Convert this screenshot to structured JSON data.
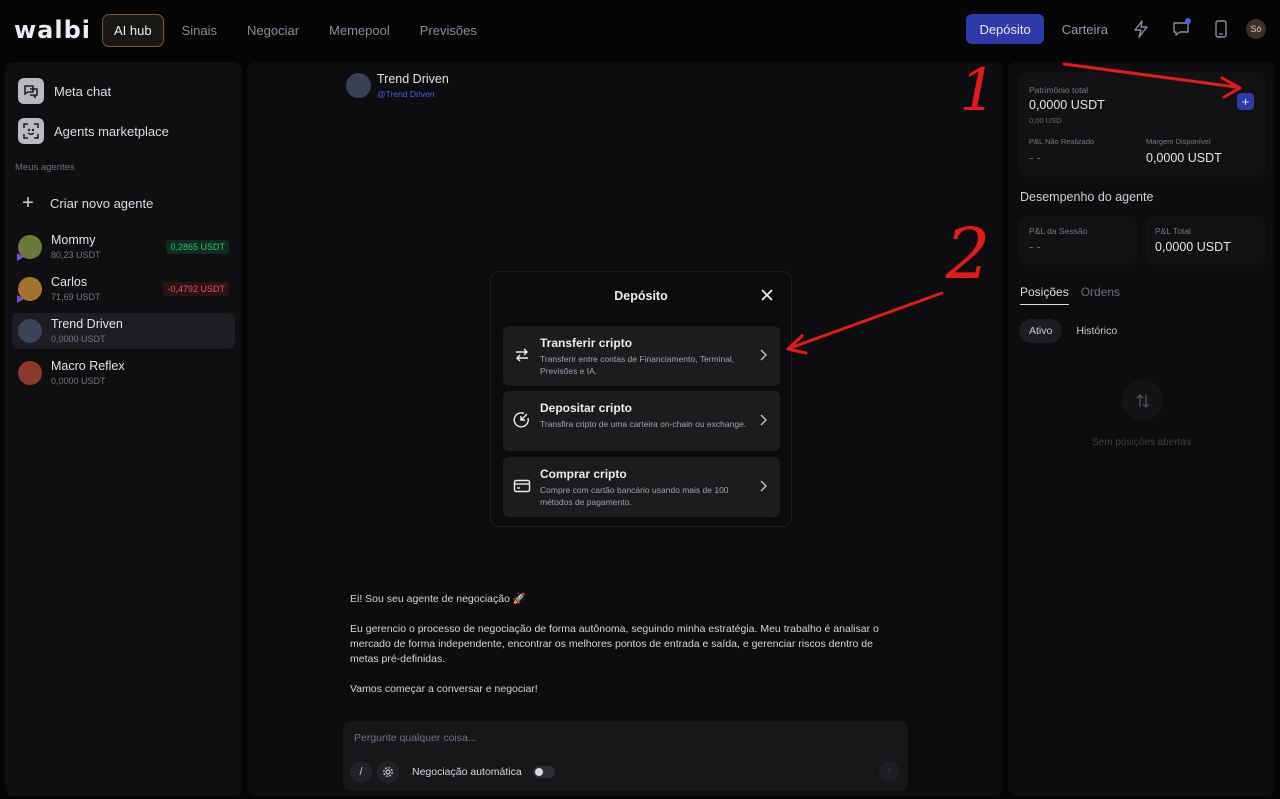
{
  "header": {
    "logo": "walbi",
    "nav": [
      {
        "label": "AI hub",
        "active": true
      },
      {
        "label": "Sinais"
      },
      {
        "label": "Negociar"
      },
      {
        "label": "Memepool"
      },
      {
        "label": "Previsões"
      }
    ],
    "deposit_label": "Depósito",
    "wallet_label": "Carteira",
    "user_initials": "Só",
    "accent_color": "#2d3aa8"
  },
  "sidebar": {
    "links": [
      {
        "label": "Meta chat",
        "icon": "chat-icon"
      },
      {
        "label": "Agents marketplace",
        "icon": "robot-icon"
      }
    ],
    "section_title": "Meus agentes",
    "create_label": "Criar novo agente",
    "agents": [
      {
        "name": "Mommy",
        "balance": "80,23 USDT",
        "pnl": "0,2865 USDT",
        "pnl_sign": "positive"
      },
      {
        "name": "Carlos",
        "balance": "71,69 USDT",
        "pnl": "-0,4792 USDT",
        "pnl_sign": "negative"
      },
      {
        "name": "Trend Driven",
        "balance": "0,0000 USDT",
        "selected": true
      },
      {
        "name": "Macro Reflex",
        "balance": "0,0000 USDT"
      }
    ]
  },
  "chat": {
    "agent_name": "Trend Driven",
    "agent_handle": "@Trend Driven",
    "messages": [
      "Ei! Sou seu agente de negociação 🚀",
      "Eu gerencio o processo de negociação de forma autônoma, seguindo minha estratégia. Meu trabalho é analisar o mercado de forma independente, encontrar os melhores pontos de entrada e saída, e gerenciar riscos dentro de metas pré-definidas.",
      "Vamos começar a conversar e negociar!"
    ],
    "input_placeholder": "Pergunte qualquer coisa...",
    "auto_trading_label": "Negociação automática",
    "auto_trading_on": false
  },
  "modal": {
    "title": "Depósito",
    "options": [
      {
        "title": "Transferir cripto",
        "desc": "Transferir entre contas de Financiamento, Terminal, Previsões e IA.",
        "icon": "swap-arrows-icon"
      },
      {
        "title": "Depositar cripto",
        "desc": "Transfira cripto de uma carteira on-chain ou exchange.",
        "icon": "deposit-arrow-icon"
      },
      {
        "title": "Comprar cripto",
        "desc": "Compre com cartão bancário usando mais de 100 métodos de pagamento.",
        "icon": "card-icon"
      }
    ]
  },
  "right_panel": {
    "equity_label": "Patrimônio total",
    "equity_value": "0,0000 USDT",
    "equity_usd": "0,00 USD",
    "unrealized_label": "P&L Não Realizado",
    "unrealized_value": "- -",
    "margin_label": "Margem Disponível",
    "margin_value": "0,0000 USDT",
    "performance_title": "Desempenho do agente",
    "session_pnl_label": "P&L da Sessão",
    "session_pnl_value": "- -",
    "total_pnl_label": "P&L Total",
    "total_pnl_value": "0,0000 USDT",
    "tabs": [
      "Posições",
      "Ordens"
    ],
    "filters": [
      "Ativo",
      "Histórico"
    ],
    "empty_text": "Sem posições abertas"
  },
  "annotations": [
    "1",
    "2"
  ]
}
